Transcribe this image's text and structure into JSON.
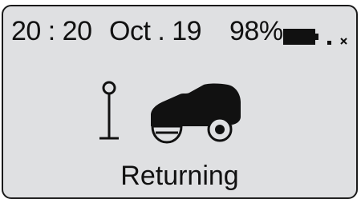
{
  "status_bar": {
    "time": "20 : 20",
    "date": "Oct . 19",
    "battery_percent": "98%",
    "battery_level": 0.98,
    "signal": "no-signal"
  },
  "main": {
    "status_label": "Returning",
    "icons": [
      "charging-station-icon",
      "robot-mower-icon"
    ]
  },
  "colors": {
    "screen_background": "#dfe0e2",
    "foreground": "#111111"
  }
}
